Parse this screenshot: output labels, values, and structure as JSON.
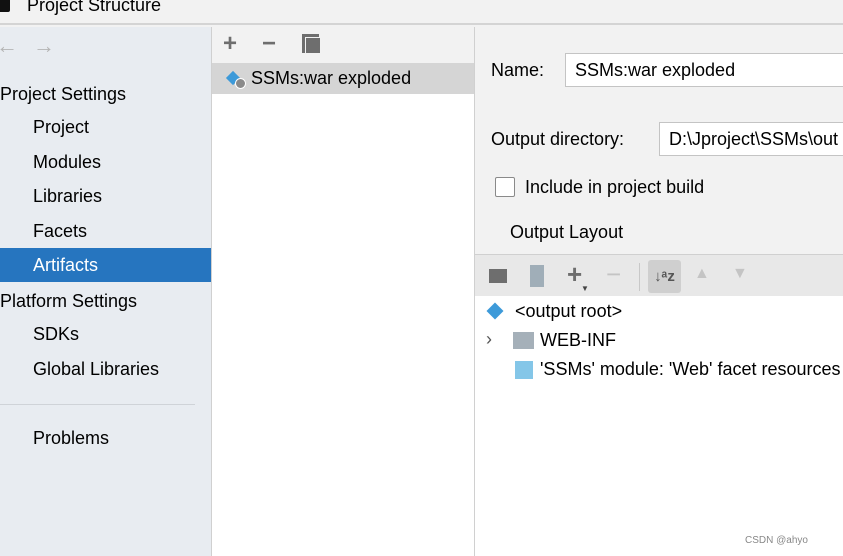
{
  "window": {
    "title": "Project Structure"
  },
  "sidebar": {
    "back": "←",
    "forward": "→",
    "sections": [
      {
        "label": "Project Settings",
        "items": [
          "Project",
          "Modules",
          "Libraries",
          "Facets",
          "Artifacts"
        ]
      },
      {
        "label": "Platform Settings",
        "items": [
          "SDKs",
          "Global Libraries"
        ]
      }
    ],
    "problems": "Problems",
    "selected": "Artifacts"
  },
  "artifacts": {
    "items": [
      {
        "label": "SSMs:war exploded",
        "selected": true
      }
    ]
  },
  "detail": {
    "name_label": "Name:",
    "name_value": "SSMs:war exploded",
    "output_dir_label": "Output directory:",
    "output_dir_value": "D:\\Jproject\\SSMs\\out",
    "include_label": "Include in project build",
    "include_checked": false,
    "output_layout_tab": "Output Layout",
    "tree": [
      {
        "label": "<output root>",
        "icon": "artifact-icon"
      },
      {
        "label": "WEB-INF",
        "icon": "folder-icon",
        "expandable": true
      },
      {
        "label": "'SSMs' module: 'Web' facet resources",
        "icon": "web-facet-icon"
      }
    ]
  },
  "watermark": "CSDN @ahyo",
  "colors": {
    "selection": "#2675bf",
    "accent": "#3d9ad9"
  }
}
